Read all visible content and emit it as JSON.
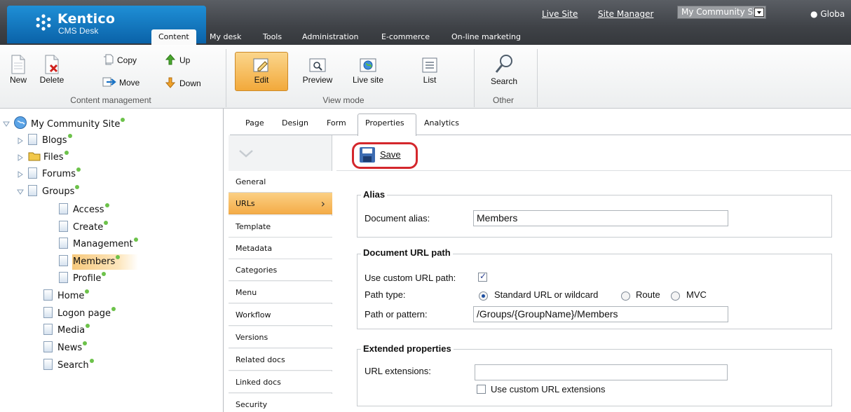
{
  "header": {
    "brand": "Kentico",
    "brand_sub": "CMS Desk",
    "tabs": [
      "Content",
      "My desk",
      "Tools",
      "Administration",
      "E-commerce",
      "On-line marketing"
    ],
    "active_tab": "Content",
    "links": [
      "Live Site",
      "Site Manager"
    ],
    "site_selector": "My Community Site",
    "user": "Globa"
  },
  "ribbon": {
    "content_management": {
      "label": "Content management",
      "new": "New",
      "delete": "Delete",
      "copy": "Copy",
      "move": "Move",
      "up": "Up",
      "down": "Down"
    },
    "view_mode": {
      "label": "View mode",
      "edit": "Edit",
      "preview": "Preview",
      "live_site": "Live site",
      "list": "List"
    },
    "other": {
      "label": "Other",
      "search": "Search"
    }
  },
  "tree": {
    "root": "My Community Site",
    "items": [
      {
        "label": "Blogs"
      },
      {
        "label": "Files"
      },
      {
        "label": "Forums"
      },
      {
        "label": "Groups"
      },
      {
        "label": "Access"
      },
      {
        "label": "Create"
      },
      {
        "label": "Management"
      },
      {
        "label": "Members"
      },
      {
        "label": "Profile"
      },
      {
        "label": "Home"
      },
      {
        "label": "Logon page"
      },
      {
        "label": "Media"
      },
      {
        "label": "News"
      },
      {
        "label": "Search"
      }
    ],
    "selected": "Members"
  },
  "page_tabs": [
    "Page",
    "Design",
    "Form",
    "Properties",
    "Analytics"
  ],
  "active_page_tab": "Properties",
  "properties_nav": [
    "General",
    "URLs",
    "Template",
    "Metadata",
    "Categories",
    "Menu",
    "Workflow",
    "Versions",
    "Related docs",
    "Linked docs",
    "Security"
  ],
  "active_properties_nav": "URLs",
  "toolbar": {
    "save_label": "Save"
  },
  "alias_section": {
    "title": "Alias",
    "document_alias_label": "Document alias:",
    "document_alias_value": "Members"
  },
  "url_path_section": {
    "title": "Document URL path",
    "use_custom_label": "Use custom URL path:",
    "use_custom_checked": true,
    "path_type_label": "Path type:",
    "path_type_options": [
      "Standard URL or wildcard",
      "Route",
      "MVC"
    ],
    "path_type_selected": "Standard URL or wildcard",
    "path_pattern_label": "Path or pattern:",
    "path_pattern_value": "/Groups/{GroupName}/Members"
  },
  "extended_section": {
    "title": "Extended properties",
    "url_extensions_label": "URL extensions:",
    "url_extensions_value": "",
    "use_custom_ext_label": "Use custom URL extensions",
    "use_custom_ext_checked": false
  },
  "colors": {
    "header_bg": "#3f4247",
    "logo_blue": "#0a62a8",
    "active_orange": "#f4ac48",
    "status_green": "#6cc24a",
    "highlight_red": "#d4272c"
  }
}
